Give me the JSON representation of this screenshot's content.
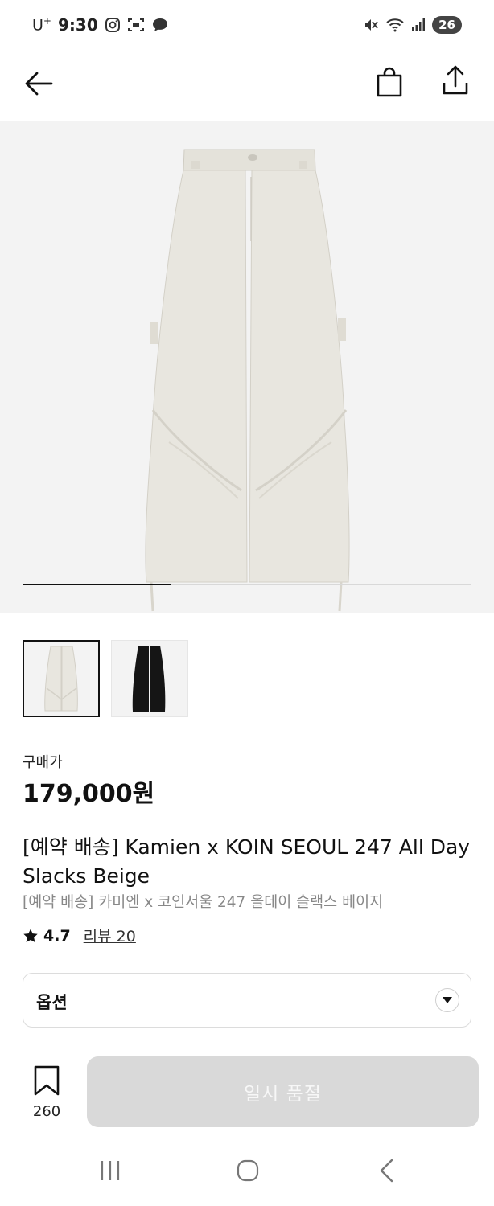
{
  "status_bar": {
    "carrier": "U",
    "carrier_sup": "+",
    "time": "9:30",
    "battery": "26"
  },
  "app_bar": {
    "icons": [
      "back-arrow-icon",
      "shopping-bag-icon",
      "share-icon"
    ]
  },
  "gallery": {
    "progress": 0.33,
    "thumbnails": [
      {
        "color": "beige",
        "selected": true
      },
      {
        "color": "black",
        "selected": false
      }
    ]
  },
  "product": {
    "price_label": "구매가",
    "price": "179,000원",
    "title_en": "[예약 배송] Kamien x KOIN SEOUL 247 All Day Slacks Beige",
    "title_ko": "[예약 배송] 카미엔 x 코인서울 247 올데이 슬랙스 베이지",
    "rating": "4.7",
    "review_link": "리뷰 20"
  },
  "options": {
    "label": "옵션"
  },
  "bottom_bar": {
    "bookmark_count": "260",
    "buy_button": "일시 품절"
  },
  "colors": {
    "beige": "#e8e6df",
    "disabled_button": "#d9d9d9",
    "image_bg": "#f3f3f3"
  }
}
